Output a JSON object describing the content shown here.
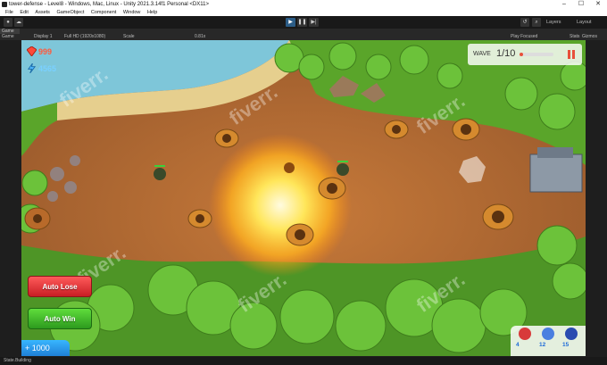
{
  "window": {
    "title": "tower-defense - Level8 - Windows, Mac, Linux - Unity 2021.3.14f1 Personal <DX11>",
    "controls": [
      "–",
      "☐",
      "✕"
    ]
  },
  "menu": [
    "File",
    "Edit",
    "Assets",
    "GameObject",
    "Component",
    "Window",
    "Help"
  ],
  "toolbar": {
    "play_icon": "▶",
    "pause_icon": "❚❚",
    "step_icon": "▶|",
    "layers": "Layers",
    "layout": "Layout"
  },
  "tabs": {
    "game": "Game"
  },
  "game_options": {
    "mode": "Game",
    "display": "Display 1",
    "resolution": "Full HD (1920x1080)",
    "scale_label": "Scale",
    "scale_value": "0.81x",
    "play_focused": "Play Focused",
    "stats": "Stats",
    "gizmos": "Gizmos"
  },
  "hud": {
    "gems": "999",
    "energy": "4565",
    "wave_label": "WAVE",
    "wave_value": "1/10",
    "wave_progress": 0.1,
    "auto_lose": "Auto Lose",
    "auto_win": "Auto Win",
    "money": "+ 1000",
    "units": [
      {
        "name": "red-unit-icon",
        "count": "4",
        "color": "#d83a3a"
      },
      {
        "name": "blue-unit-icon",
        "count": "12",
        "color": "#4a7fe0"
      },
      {
        "name": "mage-unit-icon",
        "count": "15",
        "color": "#2a4bb0"
      }
    ]
  },
  "watermark": "fiverr.",
  "status": {
    "text": "State.Building"
  },
  "colors": {
    "ground": "#b06a34",
    "grass": "#5aa52a",
    "tree": "#6cc23a",
    "water": "#7ec6d9",
    "tower": "#d58a2e",
    "blast": "#ffd94a"
  }
}
